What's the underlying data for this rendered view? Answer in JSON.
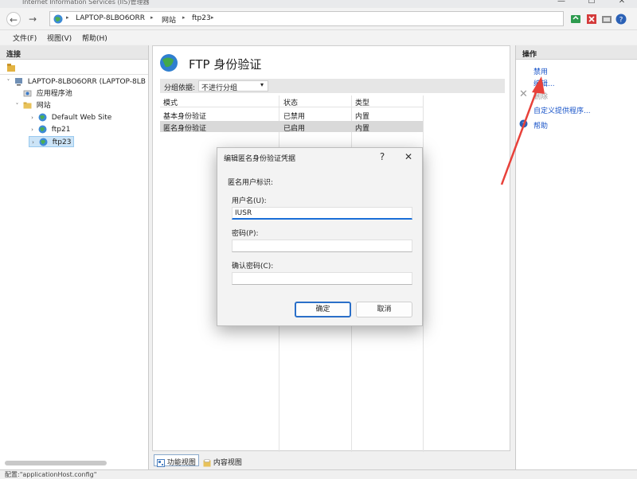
{
  "window": {
    "title": "Internet Information Services (IIS)管理器",
    "min": "—",
    "max": "☐",
    "close": "✕"
  },
  "address": {
    "crumbs": [
      "LAPTOP-8LBO6ORR",
      "网站",
      "ftp23"
    ],
    "sep": "▸"
  },
  "menu": {
    "items": [
      "文件(F)",
      "视图(V)",
      "帮助(H)"
    ]
  },
  "left": {
    "header": "连接",
    "tree": [
      {
        "label": "LAPTOP-8LBO6ORR (LAPTOP-8LB",
        "toggle": "˅"
      },
      {
        "label": "应用程序池",
        "toggle": ""
      },
      {
        "label": "网站",
        "toggle": "˅"
      },
      {
        "label": "Default Web Site",
        "toggle": "›"
      },
      {
        "label": "ftp21",
        "toggle": "›"
      },
      {
        "label": "ftp23",
        "toggle": "›"
      }
    ]
  },
  "center": {
    "title": "FTP 身份验证",
    "group_label": "分组依据:",
    "group_value": "不进行分组",
    "group_arrow": "▾",
    "columns": [
      "模式",
      "状态",
      "类型"
    ],
    "rows": [
      [
        "基本身份验证",
        "已禁用",
        "内置"
      ],
      [
        "匿名身份验证",
        "已启用",
        "内置"
      ]
    ],
    "tabs": [
      "功能视图",
      "内容视图"
    ]
  },
  "right": {
    "header": "操作",
    "actions": [
      "禁用",
      "编辑...",
      "删除",
      "自定义提供程序...",
      "帮助"
    ]
  },
  "dialog": {
    "title": "编辑匿名身份验证凭据",
    "help": "?",
    "close": "✕",
    "section": "匿名用户标识:",
    "username_label": "用户名(U):",
    "username_value": "IUSR",
    "password_label": "密码(P):",
    "confirm_label": "确认密码(C):",
    "ok": "确定",
    "cancel": "取消"
  },
  "status": {
    "text": "配置:\"applicationHost.config\""
  },
  "colors": {
    "accent": "#1a6ed8",
    "link": "#1a55c9",
    "annotation": "#e8413a"
  }
}
